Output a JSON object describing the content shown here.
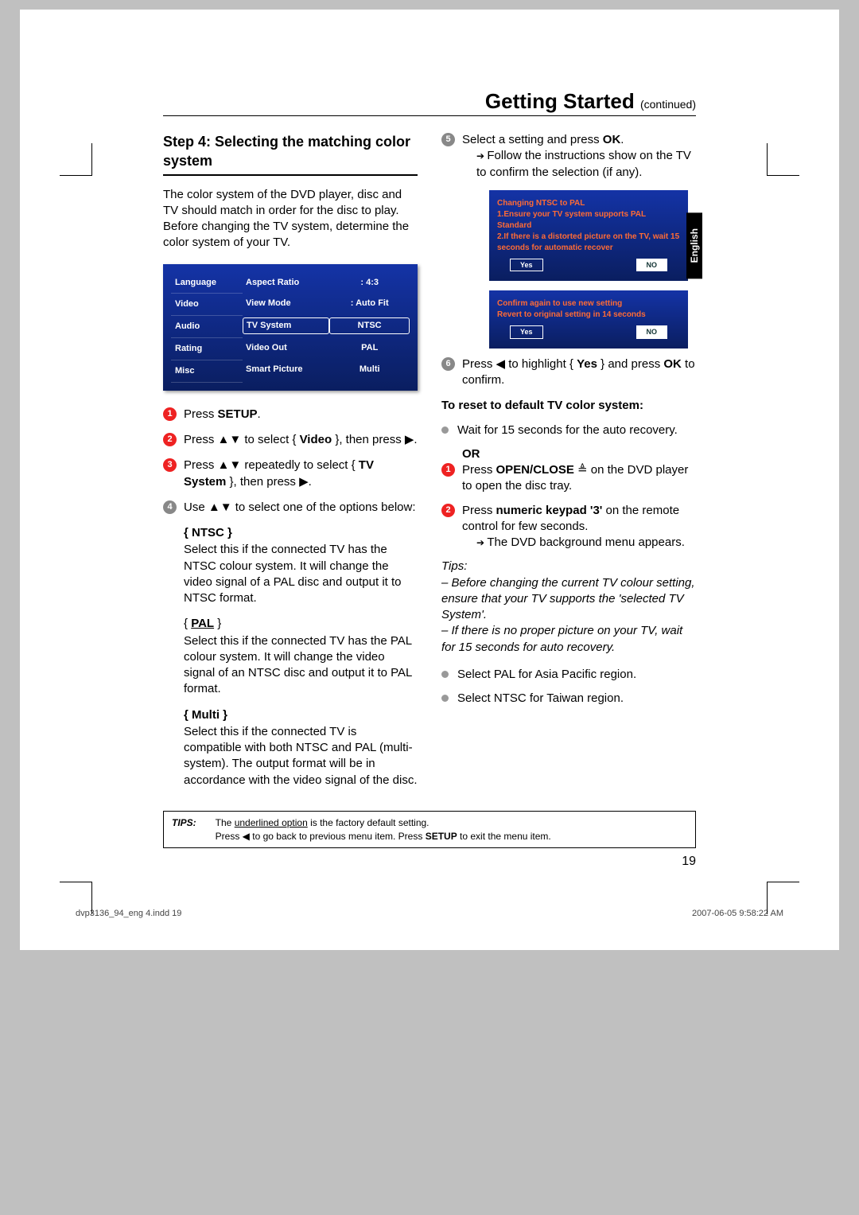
{
  "header": {
    "title": "Getting Started",
    "continued": "(continued)"
  },
  "languageTab": "English",
  "leftColumn": {
    "subheading": "Step 4:  Selecting the matching color system",
    "intro": "The color system of the DVD player, disc and TV should match in order for the disc to play. Before changing the TV system, determine the color system of your TV.",
    "menu": {
      "tabs": [
        "Language",
        "Video",
        "Audio",
        "Rating",
        "Misc"
      ],
      "rows": [
        {
          "label": "Aspect Ratio",
          "value": ": 4:3",
          "hl": false
        },
        {
          "label": "View Mode",
          "value": ": Auto Fit",
          "hl": false
        },
        {
          "label": "TV System",
          "value": "NTSC",
          "hl": true
        },
        {
          "label": "Video Out",
          "value": "PAL",
          "hl": false
        },
        {
          "label": "Smart Picture",
          "value": "Multi",
          "hl": false
        }
      ]
    },
    "steps": [
      {
        "pre": "Press ",
        "bold": "SETUP",
        "post": "."
      },
      {
        "pre": "Press ▲▼ to select { ",
        "bold": "Video",
        "post": " }, then press ▶."
      },
      {
        "pre": "Press ▲▼ repeatedly to select { ",
        "bold": "TV System",
        "post": " }, then press ▶."
      },
      {
        "pre": "Use ▲▼ to select one of the options below:",
        "bold": "",
        "post": "",
        "grey": true
      }
    ],
    "options": [
      {
        "title": "{ NTSC }",
        "titleBold": true,
        "desc": "Select this if the connected TV has the NTSC colour system. It will change the video signal of a PAL disc and output it to NTSC format."
      },
      {
        "title": "{ PAL }",
        "titleBold": true,
        "underline": true,
        "desc": "Select this if the connected TV has the PAL colour system. It will change the video signal of an NTSC disc and output it to PAL format."
      },
      {
        "title": "{ Multi }",
        "titleBold": true,
        "desc": "Select this if the connected TV is compatible with both NTSC and PAL (multi-system). The output format will be in accordance with the video signal of the disc."
      }
    ]
  },
  "rightColumn": {
    "step5": {
      "pre": "Select a setting and press ",
      "bold": "OK",
      "post": ".",
      "sub": "Follow the instructions show on the TV to confirm the selection (if any).",
      "num": "5",
      "grey": true
    },
    "dialog1": {
      "lines": "Changing NTSC to PAL\n1.Ensure your TV system supports PAL Standard\n2.If there is a distorted picture on the TV, wait 15 seconds for automatic recover",
      "yes": "Yes",
      "no": "NO"
    },
    "dialog2": {
      "lines": "Confirm again to use new setting\nRevert to original setting in 14 seconds",
      "yes": "Yes",
      "no": "NO"
    },
    "step6": {
      "pre": "Press ◀ to highlight { ",
      "bold": "Yes",
      "post": " } and press ",
      "bold2": "OK",
      "post2": " to confirm.",
      "num": "6",
      "grey": true
    },
    "resetHeading": "To reset to default TV color system:",
    "waitText": "Wait for 15 seconds for the auto recovery.",
    "or": "OR",
    "resetSteps": [
      {
        "pre": "Press ",
        "bold": "OPEN/CLOSE",
        "post": " ≜ on the DVD player to open the disc tray."
      },
      {
        "pre": "Press ",
        "bold": "numeric keypad '3'",
        "post": " on the remote control for few seconds.",
        "sub": "The DVD background menu appears."
      }
    ],
    "tipsLabel": "Tips:",
    "tips": [
      "– Before changing the current TV colour setting, ensure that your TV supports the 'selected TV System'.",
      "– If there is no proper picture on your TV, wait for 15 seconds for auto recovery."
    ],
    "regionBullets": [
      "Select PAL for Asia Pacific region.",
      "Select NTSC for Taiwan region."
    ]
  },
  "tipsBox": {
    "label": "TIPS:",
    "line1a": "The ",
    "line1u": "underlined option",
    "line1b": " is the factory default setting.",
    "line2a": "Press ◀ to go back to previous menu item. Press ",
    "line2bold": "SETUP",
    "line2b": " to exit the menu item."
  },
  "pageNumber": "19",
  "footer": {
    "left": "dvp3136_94_eng 4.indd   19",
    "right": "2007-06-05   9:58:22 AM"
  }
}
